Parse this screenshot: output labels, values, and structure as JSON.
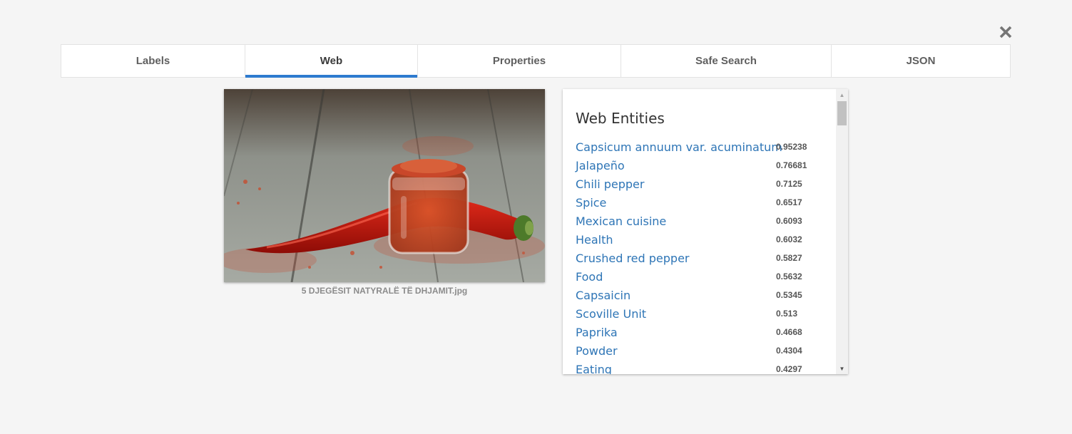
{
  "tabs": [
    {
      "label": "Labels",
      "active": false
    },
    {
      "label": "Web",
      "active": true
    },
    {
      "label": "Properties",
      "active": false
    },
    {
      "label": "Safe Search",
      "active": false
    },
    {
      "label": "JSON",
      "active": false
    }
  ],
  "close_icon": "close-icon",
  "image": {
    "caption": "5 DJEGËSIT NATYRALË TË DHJAMIT.jpg",
    "description_icon": "chili-pepper-photo"
  },
  "web_entities": {
    "title": "Web Entities",
    "items": [
      {
        "name": "Capsicum annuum var. acuminatum",
        "score": "0.95238"
      },
      {
        "name": "Jalapeño",
        "score": "0.76681"
      },
      {
        "name": "Chili pepper",
        "score": "0.7125"
      },
      {
        "name": "Spice",
        "score": "0.6517"
      },
      {
        "name": "Mexican cuisine",
        "score": "0.6093"
      },
      {
        "name": "Health",
        "score": "0.6032"
      },
      {
        "name": "Crushed red pepper",
        "score": "0.5827"
      },
      {
        "name": "Food",
        "score": "0.5632"
      },
      {
        "name": "Capsaicin",
        "score": "0.5345"
      },
      {
        "name": "Scoville Unit",
        "score": "0.513"
      },
      {
        "name": "Paprika",
        "score": "0.4668"
      },
      {
        "name": "Powder",
        "score": "0.4304"
      },
      {
        "name": "Eating",
        "score": "0.4297"
      }
    ]
  },
  "colors": {
    "accent": "#2e7bcf",
    "link": "#2e75b6",
    "background": "#f5f5f5"
  }
}
